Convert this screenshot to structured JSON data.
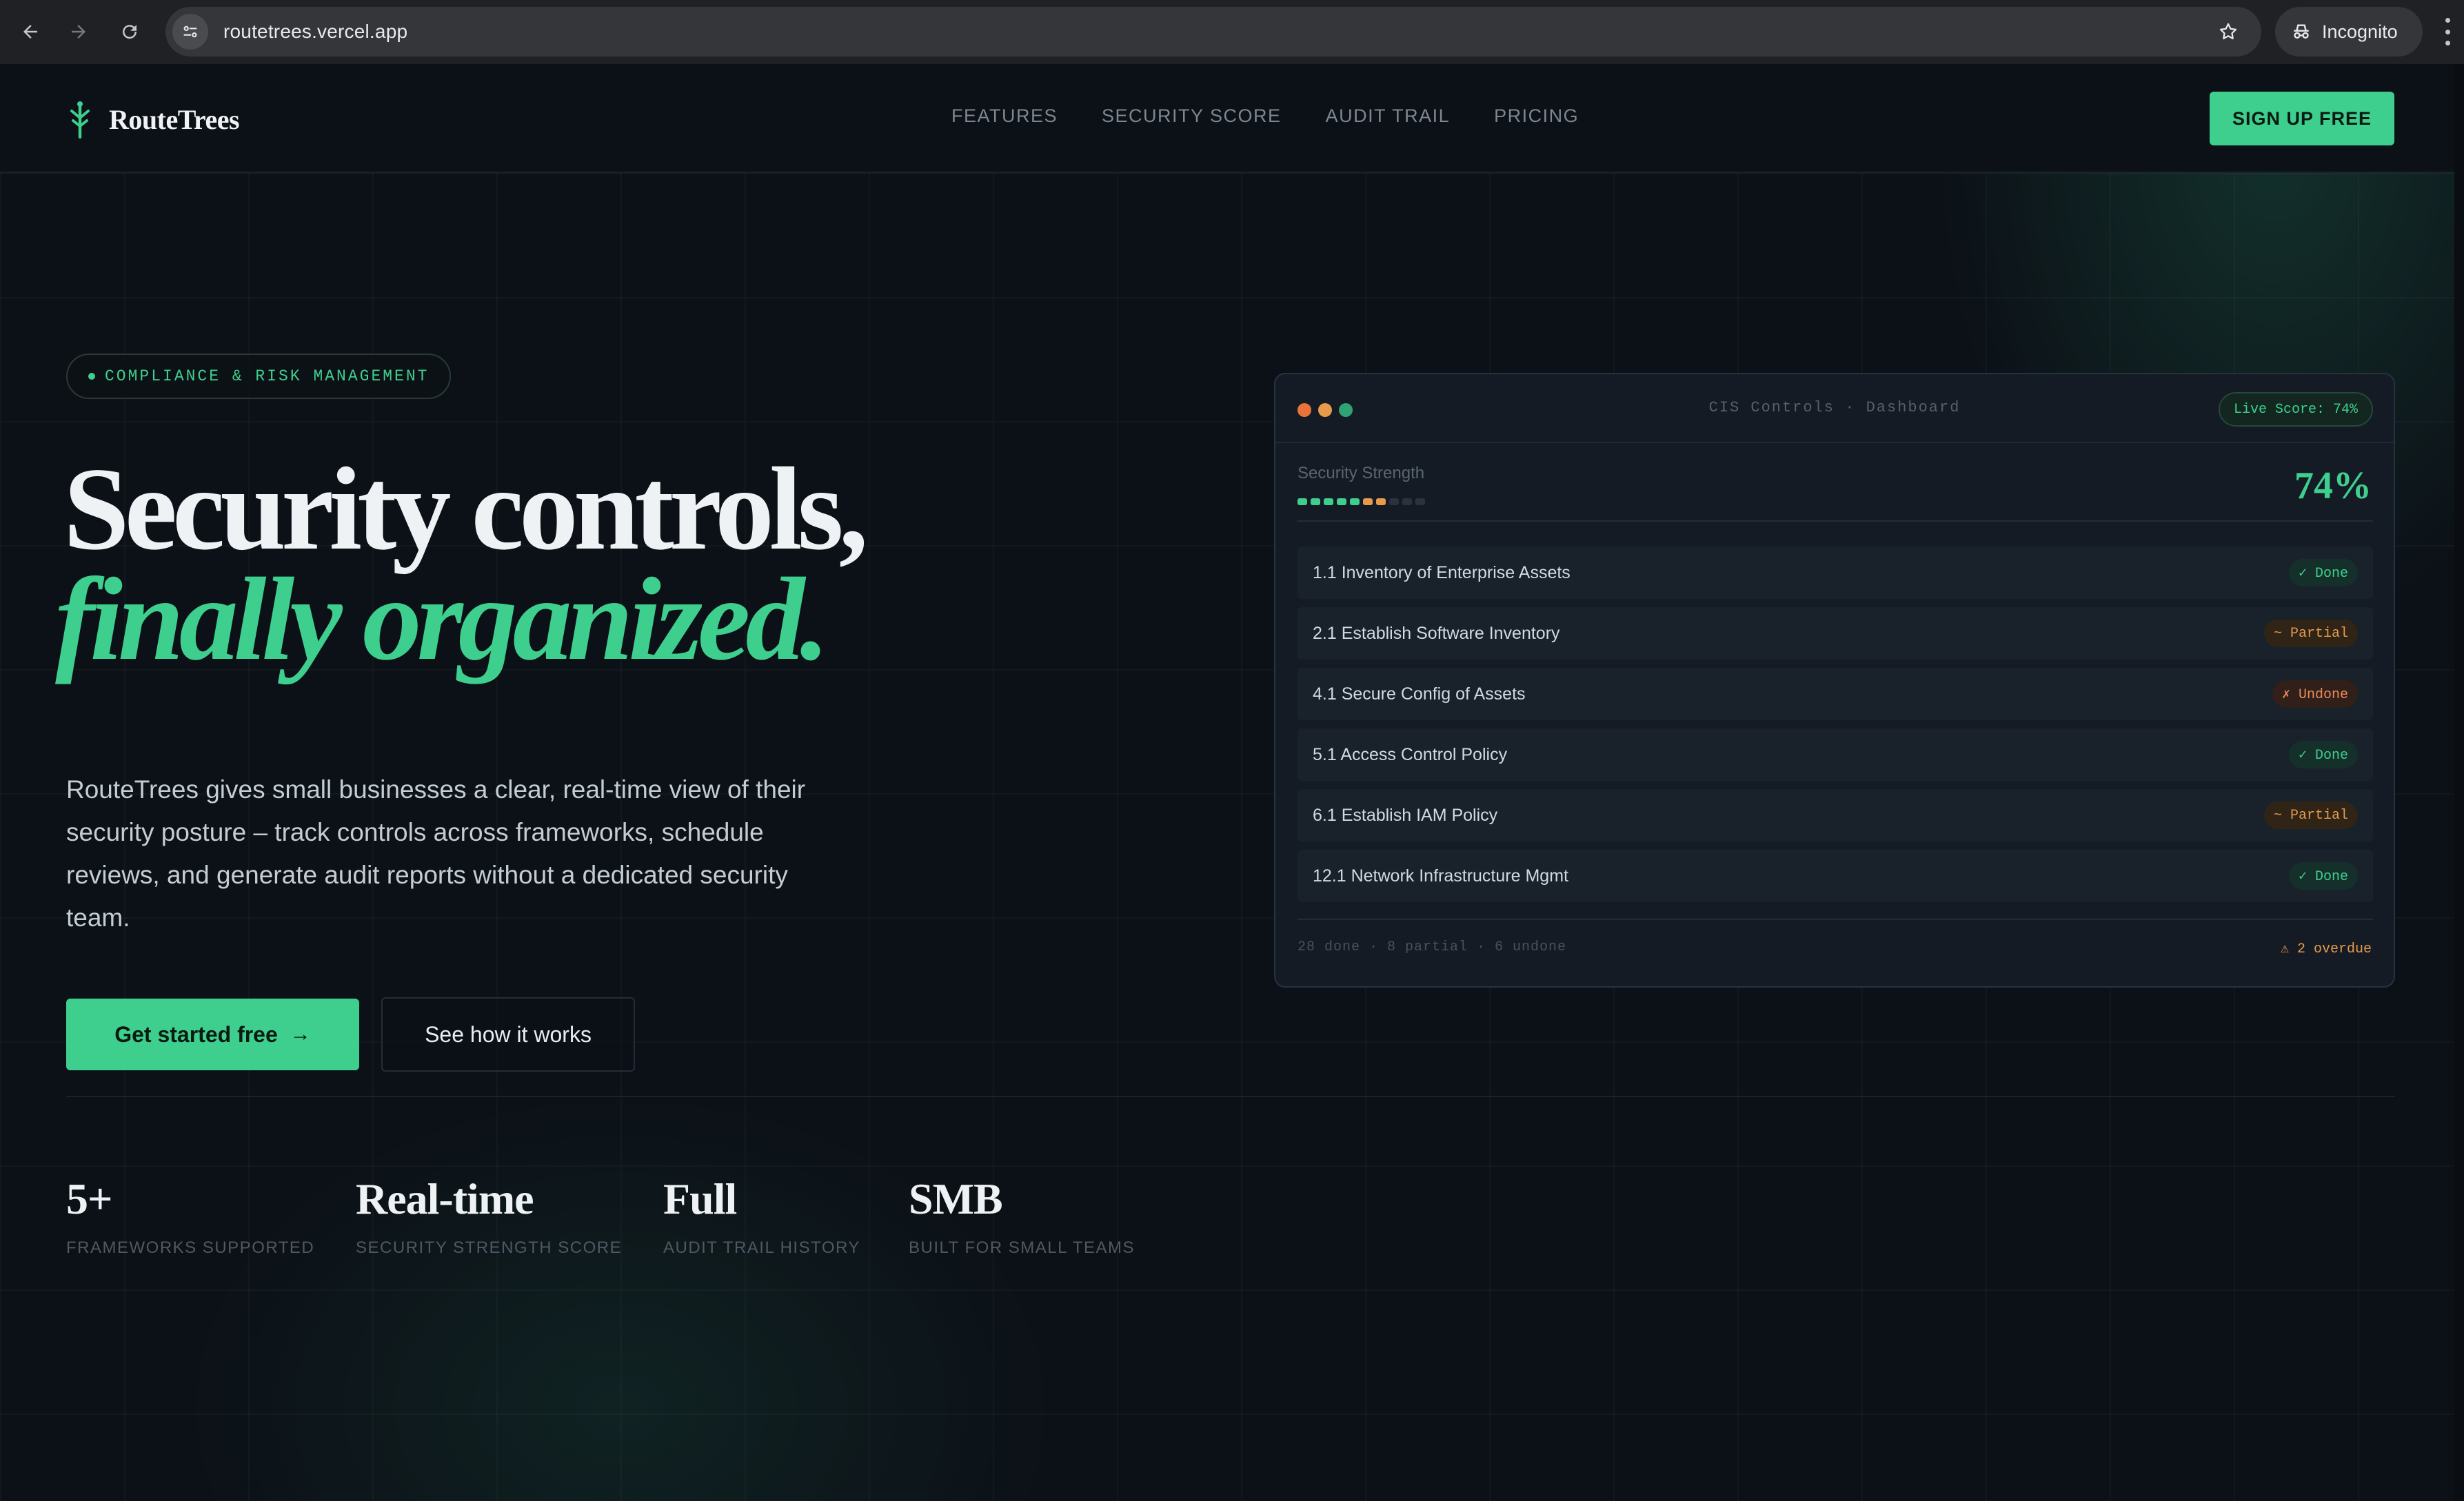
{
  "browser": {
    "url": "routetrees.vercel.app",
    "incognito_label": "Incognito"
  },
  "header": {
    "brand": "RouteTrees",
    "nav": [
      "FEATURES",
      "SECURITY SCORE",
      "AUDIT TRAIL",
      "PRICING"
    ],
    "signup_label": "SIGN UP FREE"
  },
  "hero": {
    "pill": "COMPLIANCE & RISK MANAGEMENT",
    "headline_line1": "Security controls,",
    "headline_line2": "finally organized.",
    "lede": "RouteTrees gives small businesses a clear, real-time view of their security posture – track controls across frameworks, schedule reviews, and generate audit reports without a dedicated security team.",
    "cta_primary": "Get started free",
    "cta_primary_arrow": "→",
    "cta_secondary": "See how it works"
  },
  "dashboard": {
    "title": "CIS Controls · Dashboard",
    "live_score": "Live Score: 74%",
    "strength_label": "Security Strength",
    "strength_value": "74%",
    "strength_fraction": 0.74,
    "rows": [
      {
        "name": "1.1 Inventory of Enterprise Assets",
        "status": "✓ Done",
        "kind": "done"
      },
      {
        "name": "2.1 Establish Software Inventory",
        "status": "~ Partial",
        "kind": "partial"
      },
      {
        "name": "4.1 Secure Config of Assets",
        "status": "✗ Undone",
        "kind": "undone"
      },
      {
        "name": "5.1 Access Control Policy",
        "status": "✓ Done",
        "kind": "done"
      },
      {
        "name": "6.1 Establish IAM Policy",
        "status": "~ Partial",
        "kind": "partial"
      },
      {
        "name": "12.1 Network Infrastructure Mgmt",
        "status": "✓ Done",
        "kind": "done"
      }
    ],
    "footer_stats": "28 done · 8 partial · 6 undone",
    "footer_overdue": "⚠ 2 overdue"
  },
  "stats": [
    {
      "value": "5+",
      "label": "FRAMEWORKS SUPPORTED"
    },
    {
      "value": "Real-time",
      "label": "SECURITY STRENGTH SCORE"
    },
    {
      "value": "Full",
      "label": "AUDIT TRAIL HISTORY"
    },
    {
      "value": "SMB",
      "label": "BUILT FOR SMALL TEAMS"
    }
  ],
  "colors": {
    "accent": "#3ecf8e",
    "warning": "#e59a4c",
    "background": "#0c1117"
  }
}
